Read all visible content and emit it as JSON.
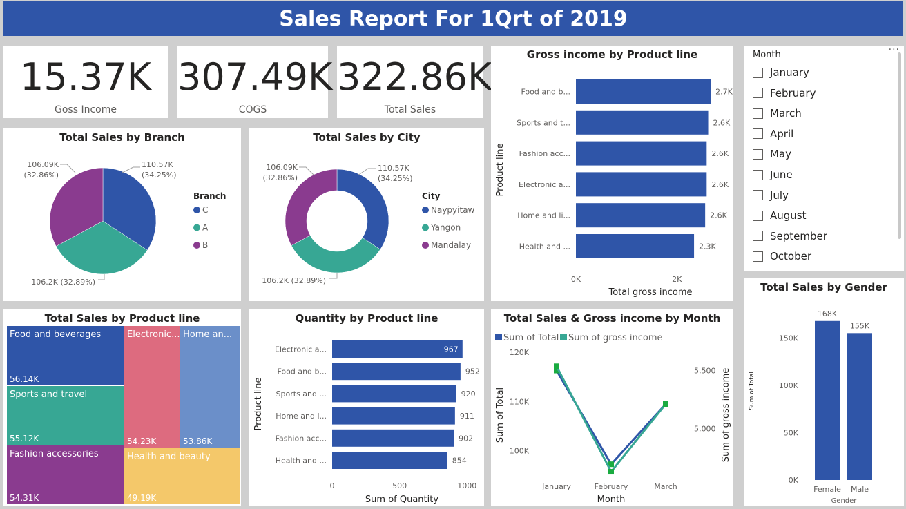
{
  "header": {
    "title": "Sales Report For 1Qrt of 2019"
  },
  "kpis": [
    {
      "value": "15.37K",
      "label": "Goss Income"
    },
    {
      "value": "307.49K",
      "label": "COGS"
    },
    {
      "value": "322.86K",
      "label": "Total Sales"
    }
  ],
  "colors": {
    "header": "#2f55a8",
    "blue": "#2f55a8",
    "teal": "#37a794",
    "purple": "#8a3b8f",
    "pink": "#dd6b7f",
    "lightblue": "#6b8fc9",
    "yellow": "#f4c86a",
    "green": "#1aab40"
  },
  "slicer": {
    "title": "Month",
    "items": [
      "January",
      "February",
      "March",
      "April",
      "May",
      "June",
      "July",
      "August",
      "September",
      "October"
    ],
    "more_icon": "more-options-icon"
  },
  "chart_data": [
    {
      "id": "branch",
      "type": "pie",
      "title": "Total Sales by Branch",
      "legend_title": "Branch",
      "legend_placement": "right",
      "slices": [
        {
          "label": "C",
          "value": 110.57,
          "data_label": "110.57K",
          "pct_label": "(34.25%)",
          "color": "#2f55a8"
        },
        {
          "label": "A",
          "value": 106.2,
          "data_label": "106.2K (32.89%)",
          "color": "#37a794"
        },
        {
          "label": "B",
          "value": 106.09,
          "data_label": "106.09K",
          "pct_label": "(32.86%)",
          "color": "#8a3b8f"
        }
      ]
    },
    {
      "id": "city",
      "type": "pie",
      "subtype": "donut",
      "title": "Total Sales by City",
      "legend_title": "City",
      "legend_placement": "right",
      "slices": [
        {
          "label": "Naypyitaw",
          "value": 110.57,
          "data_label": "110.57K",
          "pct_label": "(34.25%)",
          "color": "#2f55a8"
        },
        {
          "label": "Yangon",
          "value": 106.2,
          "data_label": "106.2K (32.89%)",
          "color": "#37a794"
        },
        {
          "label": "Mandalay",
          "value": 106.09,
          "data_label": "106.09K",
          "pct_label": "(32.86%)",
          "color": "#8a3b8f"
        }
      ]
    },
    {
      "id": "gross",
      "type": "bar",
      "orientation": "horizontal",
      "title": "Gross income by Product line",
      "xlabel": "Total gross income",
      "ylabel": "Product line",
      "categories": [
        "Food and b...",
        "Sports and t...",
        "Fashion acc...",
        "Electronic a...",
        "Home and li...",
        "Health and ..."
      ],
      "values": [
        2.67,
        2.62,
        2.59,
        2.59,
        2.56,
        2.34
      ],
      "data_labels": [
        "2.7K",
        "2.6K",
        "2.6K",
        "2.6K",
        "2.6K",
        "2.3K"
      ],
      "xlim": [
        0,
        2.9
      ],
      "xticks": [
        0,
        2
      ],
      "xtick_labels": [
        "0K",
        "2K"
      ],
      "color": "#2f55a8"
    },
    {
      "id": "treemap",
      "type": "treemap",
      "title": "Total Sales by Product line",
      "items": [
        {
          "label": "Food and beverages",
          "value": 56.14,
          "data_label": "56.14K",
          "color": "#2f55a8"
        },
        {
          "label": "Sports and travel",
          "value": 55.12,
          "data_label": "55.12K",
          "color": "#37a794"
        },
        {
          "label": "Fashion accessories",
          "value": 54.31,
          "data_label": "54.31K",
          "color": "#8a3b8f"
        },
        {
          "label": "Electronic...",
          "value": 54.23,
          "data_label": "54.23K",
          "color": "#dd6b7f"
        },
        {
          "label": "Home an...",
          "value": 53.86,
          "data_label": "53.86K",
          "color": "#6b8fc9"
        },
        {
          "label": "Health and beauty",
          "value": 49.19,
          "data_label": "49.19K",
          "color": "#f4c86a"
        }
      ]
    },
    {
      "id": "quantity",
      "type": "bar",
      "orientation": "horizontal",
      "title": "Quantity by Product line",
      "xlabel": "Sum of Quantity",
      "ylabel": "Product line",
      "categories": [
        "Electronic a...",
        "Food and b...",
        "Sports and ...",
        "Home and l...",
        "Fashion acc...",
        "Health and ..."
      ],
      "values": [
        967,
        952,
        920,
        911,
        902,
        854
      ],
      "data_labels": [
        "967",
        "952",
        "920",
        "911",
        "902",
        "854"
      ],
      "xlim": [
        0,
        1050
      ],
      "xticks": [
        0,
        500,
        1000
      ],
      "xtick_labels": [
        "0",
        "500",
        "1000"
      ],
      "color": "#2f55a8"
    },
    {
      "id": "month",
      "type": "line",
      "title": "Total Sales & Gross income by Month",
      "xlabel": "Month",
      "ylabel": "Sum of Total",
      "y2label": "Sum of gross income",
      "categories": [
        "January",
        "February",
        "March"
      ],
      "series": [
        {
          "name": "Sum of Total",
          "values": [
            116.29,
            97.22,
            109.46
          ],
          "axis": "left",
          "color": "#2f55a8"
        },
        {
          "name": "Sum of gross income",
          "values": [
            5537.7,
            4629.5,
            5212.2
          ],
          "axis": "right",
          "color": "#37a794"
        }
      ],
      "ylim": [
        95,
        121
      ],
      "yticks": [
        100,
        110,
        120
      ],
      "ytick_labels": [
        "100K",
        "110K",
        "120K"
      ],
      "y2lim": [
        4600,
        5700
      ],
      "y2ticks": [
        5000,
        5500
      ],
      "y2tick_labels": [
        "5,000",
        "5,500"
      ],
      "legend_placement": "top-left"
    },
    {
      "id": "gender",
      "type": "bar",
      "orientation": "vertical",
      "title": "Total Sales by Gender",
      "xlabel": "Gender",
      "ylabel": "Sum of Total",
      "categories": [
        "Female",
        "Male"
      ],
      "values": [
        167.88,
        155.08
      ],
      "data_labels": [
        "168K",
        "155K"
      ],
      "ylim": [
        0,
        175
      ],
      "yticks": [
        0,
        50,
        100,
        150
      ],
      "ytick_labels": [
        "0K",
        "50K",
        "100K",
        "150K"
      ],
      "color": "#2f55a8"
    }
  ]
}
